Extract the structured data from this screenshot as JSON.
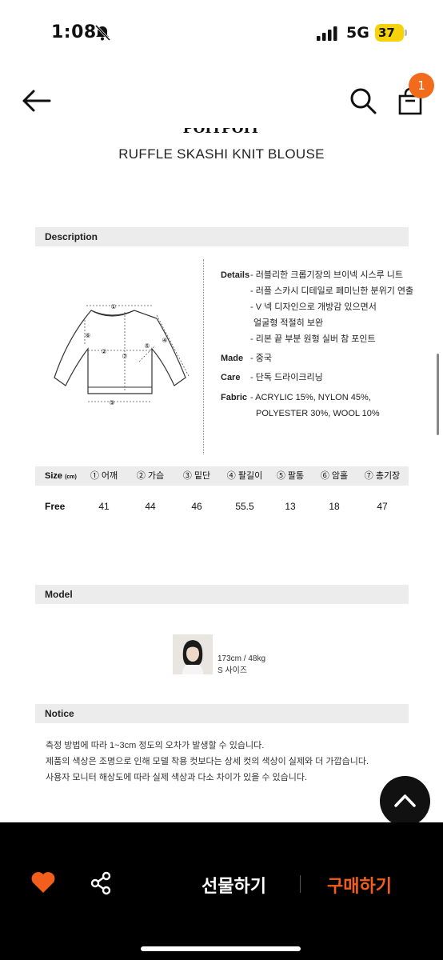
{
  "status_bar": {
    "time": "1:08",
    "network": "5G",
    "battery": "37"
  },
  "header": {
    "cart_count": "1"
  },
  "product": {
    "brand": "POITPOIT",
    "title": "RUFFLE SKASHI KNIT BLOUSE"
  },
  "description": {
    "section_title": "Description",
    "diagram_labels": [
      "①",
      "②",
      "③",
      "④",
      "⑤",
      "⑥",
      "⑦"
    ],
    "details": [
      {
        "key": "Details",
        "values": [
          "- 러블리한 크롭기장의 브이넥 시스루 니트",
          "- 러플 스카시 디테일로 페미닌한 분위기 연출",
          "- V 넥 디자인으로 개방감 있으면서",
          "  얼굴형 적절히 보완",
          "- 리본 끝 부분 원형 실버 참 포인트"
        ]
      },
      {
        "key": "Made",
        "values": [
          "- 중국"
        ]
      },
      {
        "key": "Care",
        "values": [
          "- 단독 드라이크리닝"
        ]
      },
      {
        "key": "Fabric",
        "values": [
          "- ACRYLIC 15%, NYLON 45%,",
          "  POLYESTER 30%, WOOL 10%"
        ]
      }
    ]
  },
  "size_table": {
    "size_label": "Size",
    "size_unit": "(cm)",
    "headers": [
      "① 어깨",
      "② 가슴",
      "③ 밑단",
      "④ 팔길이",
      "⑤ 팔통",
      "⑥ 암홀",
      "⑦ 총기장"
    ],
    "rows": [
      {
        "size": "Free",
        "values": [
          "41",
          "44",
          "46",
          "55.5",
          "13",
          "18",
          "47"
        ]
      }
    ]
  },
  "model": {
    "section_title": "Model",
    "height_weight": "173cm / 48kg",
    "size_worn": "S 사이즈"
  },
  "notice": {
    "section_title": "Notice",
    "lines": [
      "측정 방법에 따라 1~3cm 정도의 오차가 발생할 수 있습니다.",
      "제품의 색상은 조명으로 인해 모델 착용 컷보다는 상세 컷의 색상이 실제와 더 가깝습니다.",
      "사용자 모니터 해상도에 따라 실제 색상과 다소 차이가 있을 수 있습니다."
    ]
  },
  "bottom_bar": {
    "gift_label": "선물하기",
    "buy_label": "구매하기"
  },
  "colors": {
    "accent": "#f26b1d",
    "buy": "#f25e1c",
    "like": "#f25e1c",
    "section_bg": "#ececec"
  },
  "icons": [
    "bell-slash-icon",
    "signal-icon",
    "battery-icon",
    "back-arrow-icon",
    "search-icon",
    "shopping-bag-icon",
    "heart-icon",
    "share-icon",
    "chevron-up-icon"
  ]
}
